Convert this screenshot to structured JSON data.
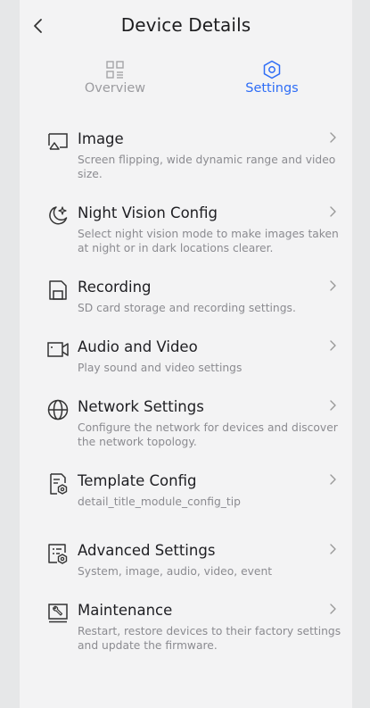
{
  "header": {
    "title": "Device Details"
  },
  "tabs": [
    {
      "label": "Overview",
      "active": false,
      "icon": "grid-icon"
    },
    {
      "label": "Settings",
      "active": true,
      "icon": "hexagon-settings-icon"
    }
  ],
  "colors": {
    "accent": "#2e6df6",
    "inactive_tab": "#9b9b9f",
    "item_title": "#1e1e22",
    "item_desc": "#8b8b90",
    "panel_bg": "#f3f3f4",
    "page_bg": "#e6e7e8"
  },
  "settings": [
    {
      "title": "Image",
      "desc": "Screen flipping, wide dynamic range and video size.",
      "icon": "image-icon"
    },
    {
      "title": "Night Vision Config",
      "desc": "Select night vision mode to make images taken at night or in dark locations clearer.",
      "icon": "moon-star-icon"
    },
    {
      "title": "Recording",
      "desc": "SD card storage and recording settings.",
      "icon": "sd-card-icon"
    },
    {
      "title": "Audio and Video",
      "desc": "Play sound and video settings",
      "icon": "video-camera-icon"
    },
    {
      "title": "Network Settings",
      "desc": "Configure the network for devices and discover the network topology.",
      "icon": "globe-icon"
    },
    {
      "title": "Template Config",
      "desc": "detail_title_module_config_tip",
      "icon": "template-config-icon"
    },
    {
      "title": "Advanced Settings",
      "desc": "System, image, audio, video, event",
      "icon": "advanced-settings-icon"
    },
    {
      "title": "Maintenance",
      "desc": "Restart, restore devices to their factory settings and update the firmware.",
      "icon": "maintenance-icon"
    }
  ]
}
